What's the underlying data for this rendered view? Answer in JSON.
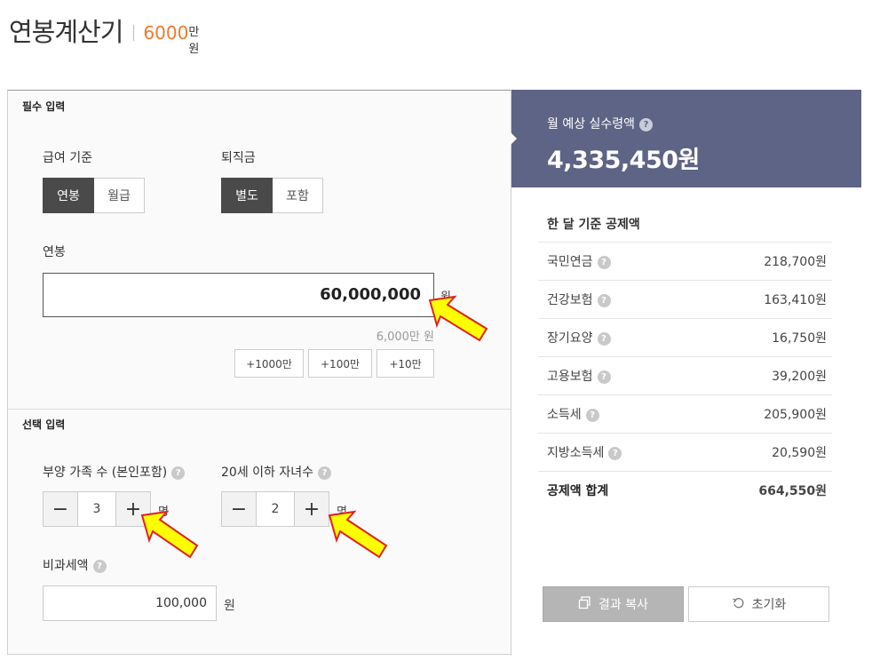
{
  "header": {
    "title": "연봉계산기",
    "amount_number": "6000",
    "amount_unit": "만원"
  },
  "required": {
    "section_label": "필수 입력",
    "pay_basis": {
      "label": "급여 기준",
      "options": [
        "연봉",
        "월급"
      ],
      "selected": "연봉"
    },
    "severance": {
      "label": "퇴직금",
      "options": [
        "별도",
        "포함"
      ],
      "selected": "별도"
    },
    "salary": {
      "label": "연봉",
      "value": "60,000,000",
      "unit": "원",
      "helper": "6,000만 원"
    },
    "quick_add": [
      "+1000만",
      "+100만",
      "+10만"
    ]
  },
  "optional": {
    "section_label": "선택 입력",
    "dependents": {
      "label": "부양 가족 수 (본인포함)",
      "value": "3",
      "unit": "명"
    },
    "children": {
      "label": "20세 이하 자녀수",
      "value": "2",
      "unit": "명"
    },
    "nontaxable": {
      "label": "비과세액",
      "value": "100,000",
      "unit": "원"
    }
  },
  "result": {
    "label": "월 예상 실수령액",
    "value": "4,335,450원",
    "deductions_title": "한 달 기준 공제액",
    "deductions": [
      {
        "name": "국민연금",
        "amount": "218,700원"
      },
      {
        "name": "건강보험",
        "amount": "163,410원"
      },
      {
        "name": "장기요양",
        "amount": "16,750원"
      },
      {
        "name": "고용보험",
        "amount": "39,200원"
      },
      {
        "name": "소득세",
        "amount": "205,900원"
      },
      {
        "name": "지방소득세",
        "amount": "20,590원"
      }
    ],
    "total": {
      "name": "공제액 합계",
      "amount": "664,550원"
    },
    "copy_label": "결과 복사",
    "reset_label": "초기화"
  },
  "colors": {
    "accent": "#f07a2a",
    "result_bg": "#5e6485",
    "active_seg": "#4a4a4a",
    "annotation_arrow": "#ffff00"
  },
  "icons": {
    "help": "?",
    "minus": "−",
    "plus": "+",
    "copy": "copy-icon",
    "reset": "reset-icon"
  }
}
